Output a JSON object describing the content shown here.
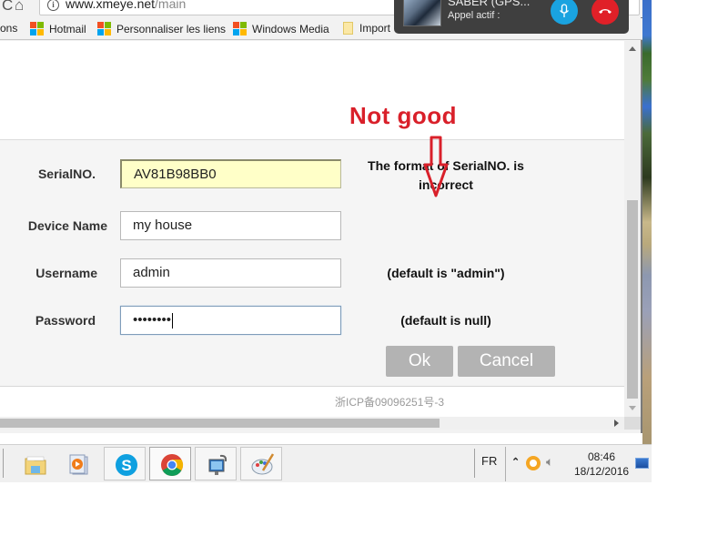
{
  "browser": {
    "url_domain": "www.xmeye.net",
    "url_path": "/main",
    "bookmarks": [
      {
        "label": "ons",
        "icon": "none"
      },
      {
        "label": "Hotmail",
        "icon": "microsoft-logo"
      },
      {
        "label": "Personnaliser les liens",
        "icon": "microsoft-logo"
      },
      {
        "label": "Windows Media",
        "icon": "microsoft-logo"
      },
      {
        "label": "Import",
        "icon": "folder-icon"
      }
    ]
  },
  "annotation": {
    "text": "Not good",
    "color": "#d9202a"
  },
  "form": {
    "fields": [
      {
        "label": "SerialNO.",
        "value": "AV81B98BB0"
      },
      {
        "label": "Device Name",
        "value": "my house"
      },
      {
        "label": "Username",
        "value": "admin"
      },
      {
        "label": "Password",
        "value": "••••••••"
      }
    ],
    "error_line1": "The format of SerialNO. is",
    "error_line2": "incorrect",
    "username_hint": "(default is \"admin\")",
    "password_hint": "(default is null)",
    "ok_label": "Ok",
    "cancel_label": "Cancel"
  },
  "footer": {
    "icp": "浙ICP备09096251号-3"
  },
  "call": {
    "caller": "SABER (GPS...",
    "status": "Appel actif :"
  },
  "taskbar": {
    "apps": [
      "file-explorer",
      "media-player",
      "skype",
      "chrome",
      "network-tool",
      "paint"
    ],
    "language": "FR",
    "time": "08:46",
    "date": "18/12/2016"
  }
}
